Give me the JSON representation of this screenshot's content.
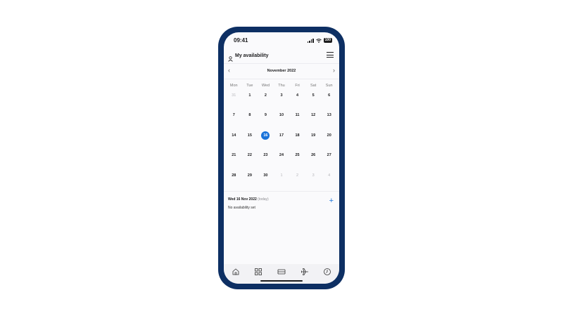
{
  "status_bar": {
    "time": "09:41",
    "battery": "100"
  },
  "header": {
    "title": "My availability",
    "icons": [
      "user-icon",
      "menu-icon"
    ]
  },
  "calendar": {
    "month": "November 2022",
    "weekdays": [
      "Mon",
      "Tue",
      "Wed",
      "Thu",
      "Fri",
      "Sat",
      "Sun"
    ],
    "days": [
      {
        "label": "31",
        "muted": true
      },
      {
        "label": "1"
      },
      {
        "label": "2"
      },
      {
        "label": "3"
      },
      {
        "label": "4"
      },
      {
        "label": "5"
      },
      {
        "label": "6"
      },
      {
        "label": "7"
      },
      {
        "label": "8"
      },
      {
        "label": "9"
      },
      {
        "label": "10"
      },
      {
        "label": "11"
      },
      {
        "label": "12"
      },
      {
        "label": "13"
      },
      {
        "label": "14"
      },
      {
        "label": "15"
      },
      {
        "label": "16",
        "today": true
      },
      {
        "label": "17"
      },
      {
        "label": "18"
      },
      {
        "label": "19"
      },
      {
        "label": "20"
      },
      {
        "label": "21"
      },
      {
        "label": "22"
      },
      {
        "label": "23"
      },
      {
        "label": "24"
      },
      {
        "label": "25"
      },
      {
        "label": "26"
      },
      {
        "label": "27"
      },
      {
        "label": "28"
      },
      {
        "label": "29"
      },
      {
        "label": "30"
      },
      {
        "label": "1",
        "muted": true
      },
      {
        "label": "2",
        "muted": true
      },
      {
        "label": "3",
        "muted": true
      },
      {
        "label": "4",
        "muted": true
      }
    ]
  },
  "availability": {
    "date": "Wed 16 Nov 2022",
    "today_tag": "(today)",
    "status": "No availability set",
    "add_label": "+"
  },
  "tabbar": {
    "items": [
      {
        "name": "home",
        "icon": "home-icon"
      },
      {
        "name": "apps",
        "icon": "grid-icon"
      },
      {
        "name": "roster",
        "icon": "bed-icon"
      },
      {
        "name": "flights",
        "icon": "plane-icon"
      },
      {
        "name": "history",
        "icon": "clock-icon"
      }
    ]
  },
  "colors": {
    "frame": "#0d2f63",
    "accent": "#1a73d9",
    "background": "#fafafc"
  }
}
